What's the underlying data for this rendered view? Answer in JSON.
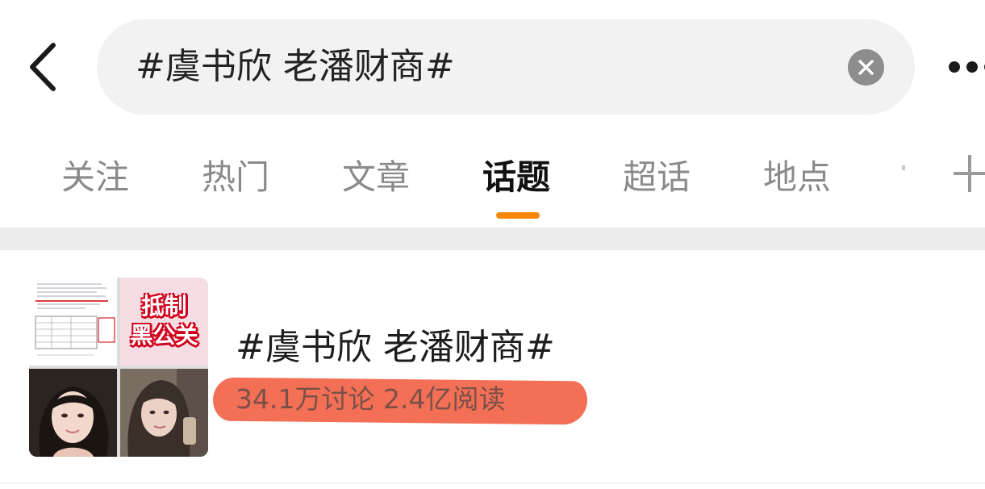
{
  "header": {
    "back_icon": "chevron-left-icon",
    "search_text": "#虞书欣 老潘财商#",
    "clear_icon": "close-icon",
    "more_icon": "more-horizontal-icon"
  },
  "tabs": [
    {
      "label": "关注",
      "active": false
    },
    {
      "label": "热门",
      "active": false
    },
    {
      "label": "文章",
      "active": false
    },
    {
      "label": "话题",
      "active": true
    },
    {
      "label": "超话",
      "active": false
    },
    {
      "label": "地点",
      "active": false
    }
  ],
  "add_tab_icon": "plus-icon",
  "accent_color": "#f7870a",
  "highlight_color": "#f2674c",
  "result": {
    "cover_text_line1": "抵制",
    "cover_text_line2": "黑公关",
    "title": "#虞书欣 老潘财商#",
    "stats": "34.1万讨论 2.4亿阅读"
  }
}
